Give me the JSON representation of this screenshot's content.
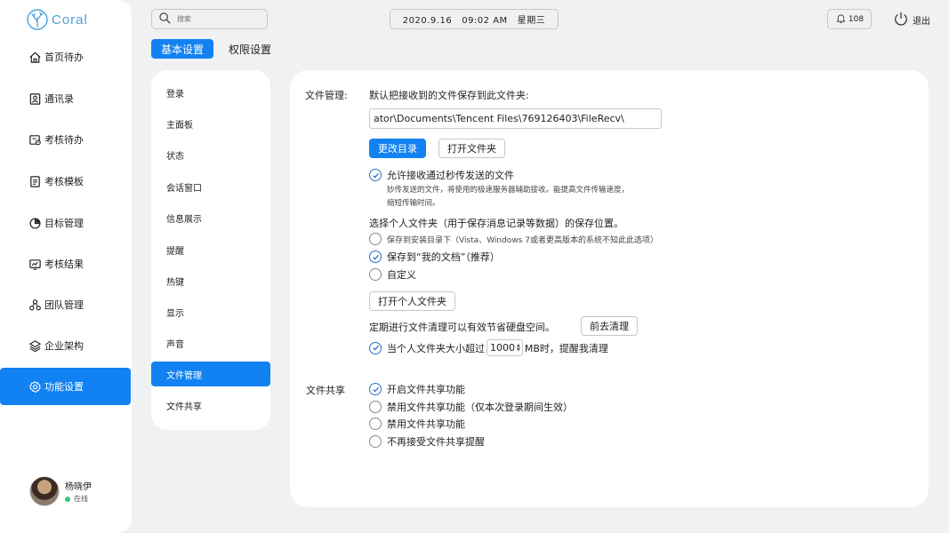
{
  "app": {
    "brand": "Coral"
  },
  "sidebar": {
    "items": [
      {
        "label": "首页待办",
        "icon": "home-icon"
      },
      {
        "label": "通讯录",
        "icon": "contacts-icon"
      },
      {
        "label": "考核待办",
        "icon": "review-todo-icon"
      },
      {
        "label": "考核模板",
        "icon": "template-icon"
      },
      {
        "label": "目标管理",
        "icon": "pie-chart-icon"
      },
      {
        "label": "考核结果",
        "icon": "result-icon"
      },
      {
        "label": "团队管理",
        "icon": "team-icon"
      },
      {
        "label": "企业架构",
        "icon": "layers-icon"
      },
      {
        "label": "功能设置",
        "icon": "gear-icon"
      }
    ],
    "active_index": 8
  },
  "user": {
    "name": "杨晓伊",
    "status": "在线",
    "status_color": "#2ecc71"
  },
  "topbar": {
    "search_placeholder": "搜索",
    "datetime": "2020.9.16   09:02 AM   星期三",
    "notification_count": "108",
    "logout_label": "退出"
  },
  "tabs": [
    {
      "label": "基本设置",
      "active": true
    },
    {
      "label": "权限设置",
      "active": false
    }
  ],
  "submenu": {
    "items": [
      "登录",
      "主面板",
      "状态",
      "会话窗口",
      "信息展示",
      "提醒",
      "热键",
      "显示",
      "声音",
      "文件管理",
      "文件共享"
    ],
    "active_index": 9
  },
  "file_management": {
    "section_label": "文件管理:",
    "default_save_text": "默认把接收到的文件保存到此文件夹:",
    "path_value": "ator\\Documents\\Tencent Files\\769126403\\FileRecv\\",
    "change_dir_button": "更改目录",
    "open_folder_button": "打开文件夹",
    "allow_receive_label": "允许接收通过秒传发送的文件",
    "allow_receive_checked": true,
    "allow_receive_desc_1": "妙传发送的文件，将使用的极速服务器辅助接收。能提高文件传输速度，",
    "allow_receive_desc_2": "缩短传输时间。",
    "personal_folder_prompt": "选择个人文件夹（用于保存消息记录等数据）的保存位置。",
    "save_options": [
      {
        "label": "保存到安装目录下（Vista、Windows 7或者更高版本的系统不知此此选项）",
        "checked": false,
        "small": true
      },
      {
        "label": "保存到“我的文档”（推荐）",
        "checked": true,
        "small": false
      },
      {
        "label": "自定义",
        "checked": false,
        "small": false
      }
    ],
    "open_personal_folder_button": "打开个人文件夹",
    "cleanup_text": "定期进行文件清理可以有效节省硬盘空间。",
    "cleanup_button": "前去清理",
    "size_prefix": "当个人文件夹大小超过",
    "size_value": "1000",
    "size_suffix": "MB时，提醒我清理",
    "size_checked": true
  },
  "file_sharing": {
    "section_label": "文件共享",
    "options": [
      {
        "label": "开启文件共享功能",
        "checked": true
      },
      {
        "label": "禁用文件共享功能（仅本次登录期间生效）",
        "checked": false
      },
      {
        "label": "禁用文件共享功能",
        "checked": false
      },
      {
        "label": "不再接受文件共享提醒",
        "checked": false
      }
    ]
  },
  "colors": {
    "accent": "#1282f2",
    "background": "#f0f1f3",
    "brand": "#4aa3d8"
  }
}
